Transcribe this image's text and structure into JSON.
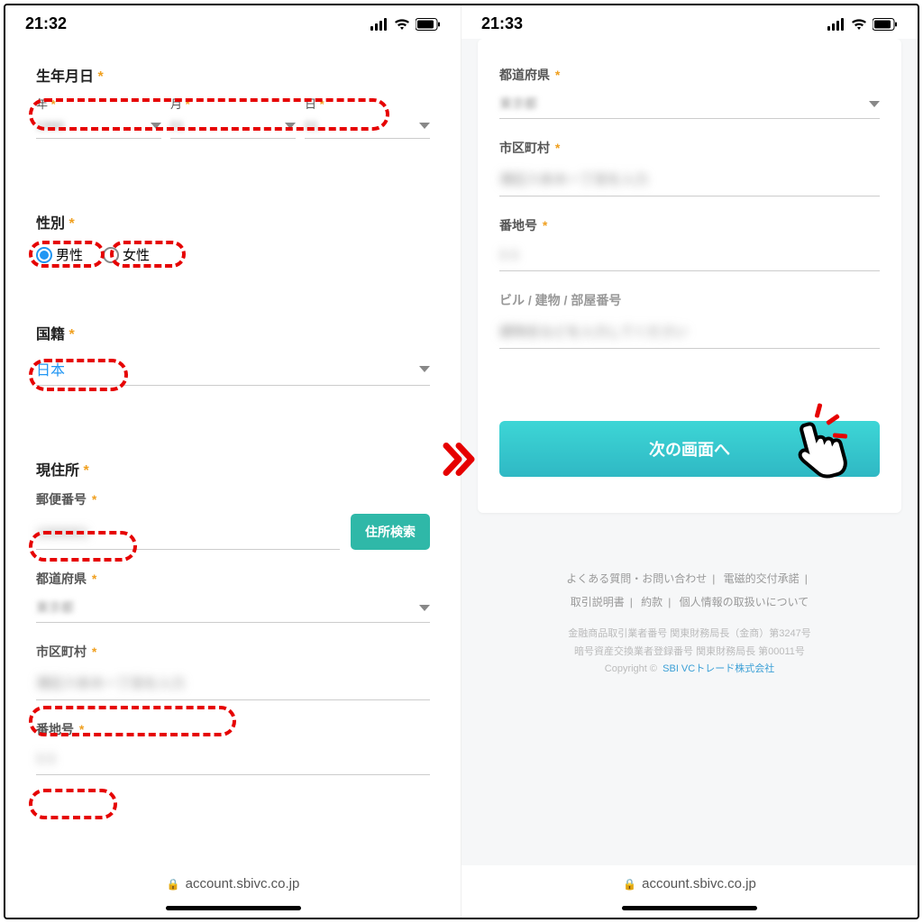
{
  "left": {
    "time": "21:32",
    "birthdate_label": "生年月日",
    "year_label": "年",
    "month_label": "月",
    "day_label": "日",
    "gender_label": "性別",
    "gender_male": "男性",
    "gender_female": "女性",
    "nationality_label": "国籍",
    "nationality_value": "日本",
    "address_label": "現住所",
    "postal_label": "郵便番号",
    "search_button": "住所検索",
    "prefecture_label": "都道府県",
    "city_label": "市区町村",
    "street_label": "番地号",
    "url": "account.sbivc.co.jp"
  },
  "right": {
    "time": "21:33",
    "prefecture_label": "都道府県",
    "city_label": "市区町村",
    "street_label": "番地号",
    "building_label": "ビル / 建物 / 部屋番号",
    "next_button": "次の画面へ",
    "faq": "よくある質問・お問い合わせ",
    "electronic": "電磁的交付承諾",
    "manual": "取引説明書",
    "terms": "約款",
    "privacy": "個人情報の取扱いについて",
    "legal1": "金融商品取引業者番号 関東財務局長（金商）第3247号",
    "legal2": "暗号資産交換業者登録番号 関東財務局長 第00011号",
    "copyright_prefix": "Copyright ©",
    "brand": "SBI VCトレード株式会社",
    "url": "account.sbivc.co.jp"
  }
}
